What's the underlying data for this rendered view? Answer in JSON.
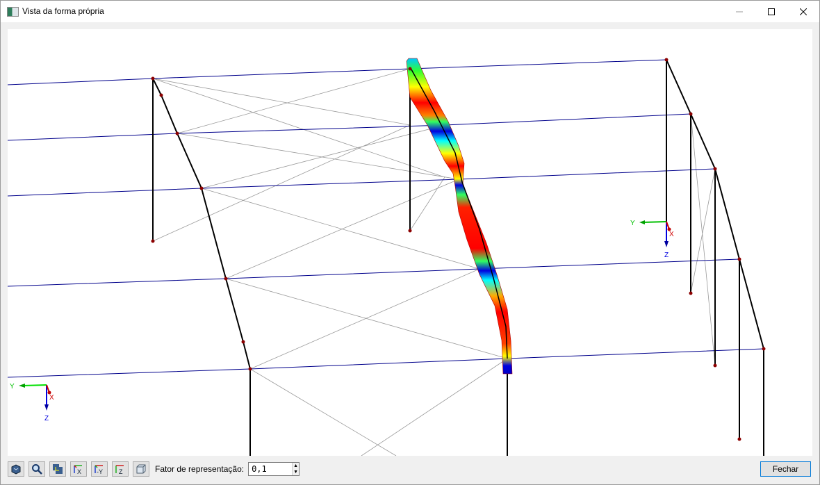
{
  "window": {
    "title": "Vista da forma própria",
    "minimize_icon": "minimize-icon",
    "maximize_icon": "maximize-icon",
    "close_icon": "close-icon"
  },
  "axes": {
    "global": {
      "y": "Y",
      "x": "X",
      "z": "Z"
    },
    "local": {
      "y": "Y",
      "x": "X",
      "z": "Z"
    }
  },
  "colors": {
    "beam": "#00008b",
    "column": "#000000",
    "bracing": "#9a9a9a",
    "node": "#8b0000",
    "axis_y": "#00c000",
    "axis_x": "#d00000",
    "axis_z": "#0000e0"
  },
  "toolbar": {
    "buttons": [
      {
        "icon": "isometric-view-icon"
      },
      {
        "icon": "zoom-icon"
      },
      {
        "icon": "render-mode-icon"
      },
      {
        "icon": "view-x-icon",
        "text": "X"
      },
      {
        "icon": "view-minus-y-icon",
        "text": "-Y"
      },
      {
        "icon": "view-z-icon",
        "text": "Z"
      },
      {
        "icon": "wireframe-box-icon"
      }
    ],
    "scale_label": "Fator de representação:",
    "scale_value": "0,1"
  },
  "close_button": "Fechar"
}
